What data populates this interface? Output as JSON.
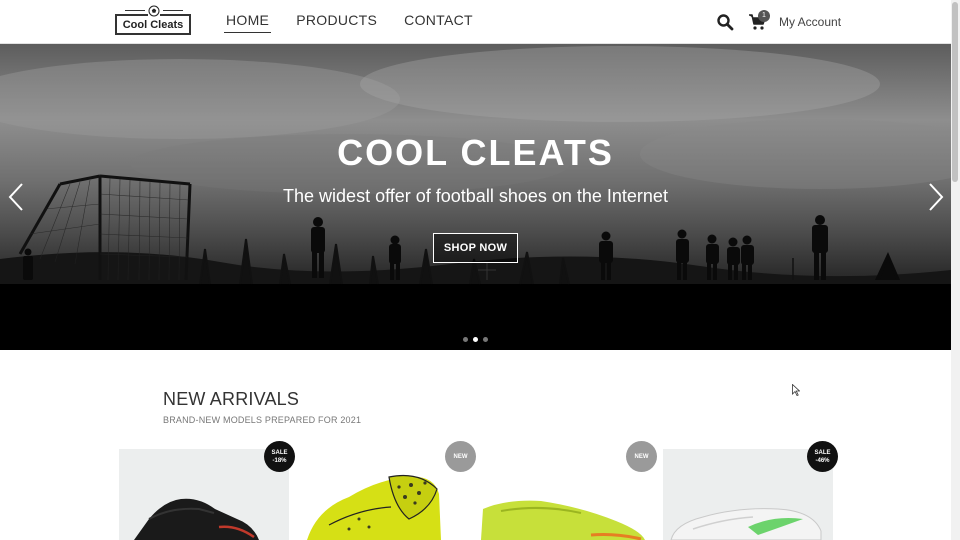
{
  "header": {
    "logo_text": "Cool Cleats",
    "nav": [
      {
        "label": "HOME",
        "active": true
      },
      {
        "label": "PRODUCTS",
        "active": false
      },
      {
        "label": "CONTACT",
        "active": false
      }
    ],
    "cart_count": "1",
    "account_label": "My Account",
    "icons": [
      "search-icon",
      "cart-icon"
    ]
  },
  "hero": {
    "title": "COOL CLEATS",
    "subtitle": "The widest offer of football shoes on the Internet",
    "cta_label": "SHOP NOW",
    "slides_total": 3,
    "active_slide": 2
  },
  "new_arrivals": {
    "title": "NEW ARRIVALS",
    "subtitle": "BRAND-NEW MODELS PREPARED FOR 2021",
    "products": [
      {
        "badge_line1": "SALE",
        "badge_line2": "-18%",
        "badge_type": "sale",
        "color": "#111111"
      },
      {
        "badge_line1": "NEW",
        "badge_line2": "",
        "badge_type": "new",
        "color": "#d6e015"
      },
      {
        "badge_line1": "NEW",
        "badge_line2": "",
        "badge_type": "new",
        "color": "#c7e03a"
      },
      {
        "badge_line1": "SALE",
        "badge_line2": "-46%",
        "badge_type": "sale",
        "color": "#f2f2f2"
      }
    ]
  },
  "colors": {
    "accent": "#333333",
    "badge_sale": "#111111",
    "badge_new": "#9a9a9a"
  }
}
